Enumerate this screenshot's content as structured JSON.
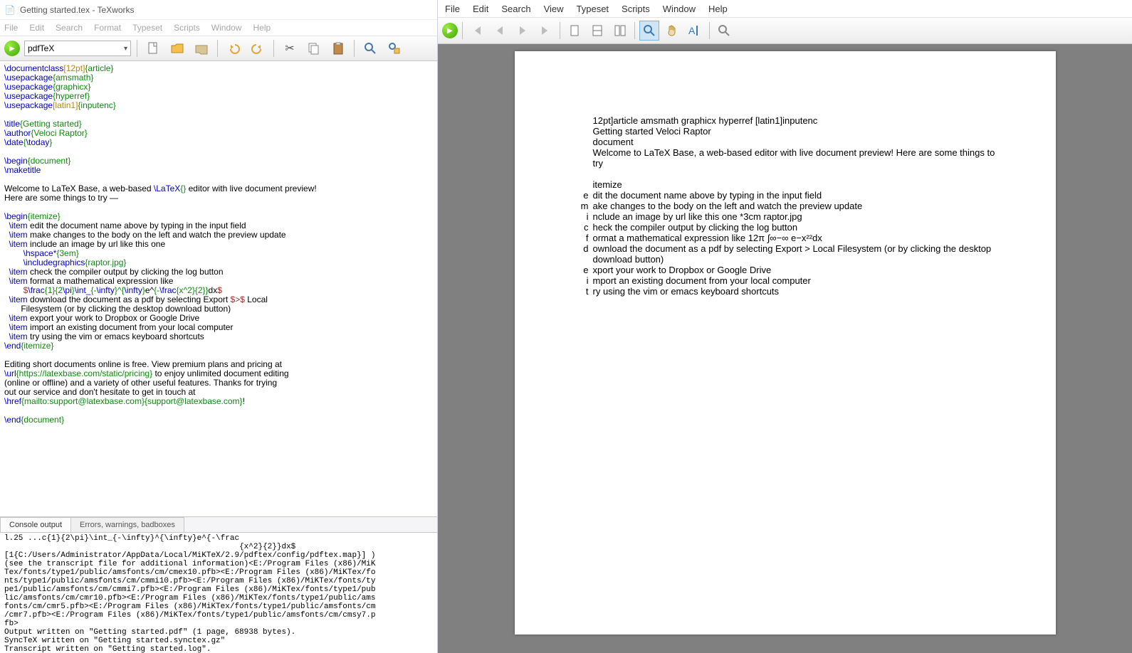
{
  "titlebar": {
    "icon_glyph": "📄",
    "text": "Getting started.tex - TeXworks"
  },
  "menu_left": [
    "File",
    "Edit",
    "Search",
    "Format",
    "Typeset",
    "Scripts",
    "Window",
    "Help"
  ],
  "menu_right": [
    "File",
    "Edit",
    "Search",
    "View",
    "Typeset",
    "Scripts",
    "Window",
    "Help"
  ],
  "engine": "pdfTeX",
  "editor_lines": [
    [
      [
        "cmd",
        "\\documentclass"
      ],
      [
        "opt",
        "[12pt]"
      ],
      [
        "grp",
        "{article}"
      ]
    ],
    [
      [
        "cmd",
        "\\usepackage"
      ],
      [
        "grp",
        "{amsmath}"
      ]
    ],
    [
      [
        "cmd",
        "\\usepackage"
      ],
      [
        "grp",
        "{graphicx}"
      ]
    ],
    [
      [
        "cmd",
        "\\usepackage"
      ],
      [
        "grp",
        "{hyperref}"
      ]
    ],
    [
      [
        "cmd",
        "\\usepackage"
      ],
      [
        "opt",
        "[latin1]"
      ],
      [
        "grp",
        "{inputenc}"
      ]
    ],
    [
      [
        "",
        ""
      ]
    ],
    [
      [
        "cmd",
        "\\title"
      ],
      [
        "grp",
        "{Getting started}"
      ]
    ],
    [
      [
        "cmd",
        "\\author"
      ],
      [
        "grp",
        "{Veloci Raptor}"
      ]
    ],
    [
      [
        "cmd",
        "\\date"
      ],
      [
        "grp",
        "{"
      ],
      [
        "cmd",
        "\\today"
      ],
      [
        "grp",
        "}"
      ]
    ],
    [
      [
        "",
        ""
      ]
    ],
    [
      [
        "cmd",
        "\\begin"
      ],
      [
        "grp",
        "{document}"
      ]
    ],
    [
      [
        "cmd",
        "\\maketitle"
      ]
    ],
    [
      [
        "",
        ""
      ]
    ],
    [
      [
        "",
        "Welcome to LaTeX Base, a web-based "
      ],
      [
        "cmd",
        "\\LaTeX"
      ],
      [
        "grp",
        "{}"
      ],
      [
        "",
        " editor with live document preview!"
      ]
    ],
    [
      [
        "",
        "Here are some things to try —"
      ]
    ],
    [
      [
        "",
        ""
      ]
    ],
    [
      [
        "cmd",
        "\\begin"
      ],
      [
        "grp",
        "{itemize}"
      ]
    ],
    [
      [
        "",
        "  "
      ],
      [
        "cmd",
        "\\item"
      ],
      [
        "",
        " edit the document name above by typing in the input field"
      ]
    ],
    [
      [
        "",
        "  "
      ],
      [
        "cmd",
        "\\item"
      ],
      [
        "",
        " make changes to the body on the left and watch the preview update"
      ]
    ],
    [
      [
        "",
        "  "
      ],
      [
        "cmd",
        "\\item"
      ],
      [
        "",
        " include an image by url like this one"
      ]
    ],
    [
      [
        "",
        "        "
      ],
      [
        "cmd",
        "\\hspace*"
      ],
      [
        "grp",
        "{3em}"
      ]
    ],
    [
      [
        "",
        "        "
      ],
      [
        "cmd",
        "\\includegraphics"
      ],
      [
        "grp",
        "{raptor.jpg}"
      ]
    ],
    [
      [
        "",
        "  "
      ],
      [
        "cmd",
        "\\item"
      ],
      [
        "",
        " check the compiler output by clicking the log button"
      ]
    ],
    [
      [
        "",
        "  "
      ],
      [
        "cmd",
        "\\item"
      ],
      [
        "",
        " format a mathematical expression like"
      ]
    ],
    [
      [
        "",
        "        "
      ],
      [
        "math",
        "$"
      ],
      [
        "cmd",
        "\\frac"
      ],
      [
        "grp",
        "{1}{2"
      ],
      [
        "cmd",
        "\\pi"
      ],
      [
        "grp",
        "}"
      ],
      [
        "cmd",
        "\\int_"
      ],
      [
        "grp",
        "{-"
      ],
      [
        "cmd",
        "\\infty"
      ],
      [
        "grp",
        "}^{"
      ],
      [
        "cmd",
        "\\infty"
      ],
      [
        "grp",
        "}"
      ],
      [
        "",
        "e^"
      ],
      [
        "grp",
        "{-"
      ],
      [
        "cmd",
        "\\frac"
      ],
      [
        "grp",
        "{x^2}{2}}"
      ],
      [
        "",
        "dx"
      ],
      [
        "math",
        "$"
      ]
    ],
    [
      [
        "",
        "  "
      ],
      [
        "cmd",
        "\\item"
      ],
      [
        "",
        " download the document as a pdf by selecting Export "
      ],
      [
        "math",
        "$>$"
      ],
      [
        "",
        " Local"
      ]
    ],
    [
      [
        "",
        "       Filesystem (or by clicking the desktop download button)"
      ]
    ],
    [
      [
        "",
        "  "
      ],
      [
        "cmd",
        "\\item"
      ],
      [
        "",
        " export your work to Dropbox or Google Drive"
      ]
    ],
    [
      [
        "",
        "  "
      ],
      [
        "cmd",
        "\\item"
      ],
      [
        "",
        " import an existing document from your local computer"
      ]
    ],
    [
      [
        "",
        "  "
      ],
      [
        "cmd",
        "\\item"
      ],
      [
        "",
        " try using the vim or emacs keyboard shortcuts"
      ]
    ],
    [
      [
        "cmd",
        "\\end"
      ],
      [
        "grp",
        "{itemize}"
      ]
    ],
    [
      [
        "",
        ""
      ]
    ],
    [
      [
        "",
        "Editing short documents online is free. View premium plans and pricing at"
      ]
    ],
    [
      [
        "cmd",
        "\\url"
      ],
      [
        "grp",
        "{https://latexbase.com/static/pricing}"
      ],
      [
        "",
        " to enjoy unlimited document editing"
      ]
    ],
    [
      [
        "",
        "(online or offline) and a variety of other useful features. Thanks for trying"
      ]
    ],
    [
      [
        "",
        "out our service and don't hesitate to get in touch at"
      ]
    ],
    [
      [
        "cmd",
        "\\href"
      ],
      [
        "grp",
        "{mailto:support@latexbase.com}{support@latexbase.com}"
      ],
      [
        "",
        "!"
      ]
    ],
    [
      [
        "",
        ""
      ]
    ],
    [
      [
        "cmd",
        "\\end"
      ],
      [
        "grp",
        "{document}"
      ]
    ]
  ],
  "log_tabs": {
    "active": "Console output",
    "inactive": "Errors, warnings, badboxes"
  },
  "log_text": "l.25 ...c{1}{2\\pi}\\int_{-\\infty}^{\\infty}e^{-\\frac\n                                                  {x^2}{2}}dx$\n[1{C:/Users/Administrator/AppData/Local/MiKTeX/2.9/pdftex/config/pdftex.map}] )\n(see the transcript file for additional information)<E:/Program Files (x86)/MiK\nTex/fonts/type1/public/amsfonts/cm/cmex10.pfb><E:/Program Files (x86)/MiKTex/fo\nnts/type1/public/amsfonts/cm/cmmi10.pfb><E:/Program Files (x86)/MiKTex/fonts/ty\npe1/public/amsfonts/cm/cmmi7.pfb><E:/Program Files (x86)/MiKTex/fonts/type1/pub\nlic/amsfonts/cm/cmr10.pfb><E:/Program Files (x86)/MiKTex/fonts/type1/public/ams\nfonts/cm/cmr5.pfb><E:/Program Files (x86)/MiKTex/fonts/type1/public/amsfonts/cm\n/cmr7.pfb><E:/Program Files (x86)/MiKTex/fonts/type1/public/amsfonts/cm/cmsy7.p\nfb>\nOutput written on \"Getting started.pdf\" (1 page, 68938 bytes).\nSyncTeX written on \"Getting started.synctex.gz\"\nTranscript written on \"Getting started.log\".",
  "pdf_lines": [
    [
      "",
      "12pt]article amsmath graphicx hyperref [latin1]inputenc"
    ],
    [
      "",
      "Getting started Veloci Raptor"
    ],
    [
      "",
      "document"
    ],
    [
      "",
      "Welcome to LaTeX Base, a web-based  editor with live document preview! Here are some things to try"
    ],
    [
      "",
      ""
    ],
    [
      "",
      "itemize"
    ],
    [
      "e",
      "dit the document name above by typing in the input field"
    ],
    [
      "m",
      "ake changes to the body on the left and watch the preview update"
    ],
    [
      "i",
      "nclude an image by url like this one *3cm raptor.jpg"
    ],
    [
      "c",
      "heck the compiler output by clicking the log button"
    ],
    [
      "f",
      "ormat a mathematical expression like 12π ∫∞−∞ e−x²²dx"
    ],
    [
      "d",
      "ownload the document as a pdf by selecting Export > Local Filesystem (or by clicking the desktop download button)"
    ],
    [
      "e",
      "xport your work to Dropbox or Google Drive"
    ],
    [
      "i",
      "mport an existing document from your local computer"
    ],
    [
      "t",
      "ry using the vim or emacs keyboard shortcuts"
    ]
  ]
}
